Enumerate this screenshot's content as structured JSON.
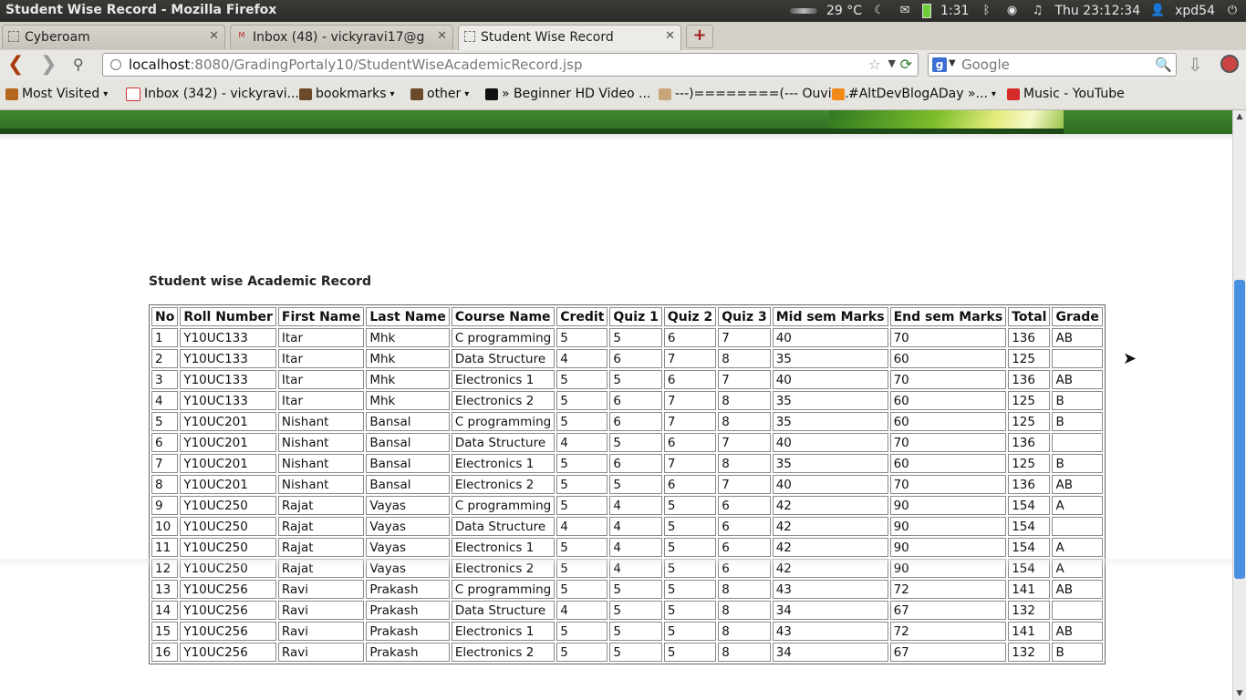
{
  "system_panel": {
    "window_title": "Student Wise Record - Mozilla Firefox",
    "temperature": "29 °C",
    "battery_time": "1:31",
    "clock": "Thu 23:12:34",
    "user": "xpd54"
  },
  "tabs": [
    {
      "label": "Cyberoam",
      "active": false
    },
    {
      "label": "Inbox (48) - vickyravi17@g...",
      "active": false
    },
    {
      "label": "Student Wise Record",
      "active": true
    }
  ],
  "nav": {
    "url_host": "localhost",
    "url_path": ":8080/GradingPortaly10/StudentWiseAcademicRecord.jsp",
    "search_placeholder": "Google"
  },
  "bookmarks": [
    {
      "label": "Most Visited",
      "menu": true
    },
    {
      "label": "Inbox (342) - vickyravi...",
      "menu": false
    },
    {
      "label": "bookmarks",
      "menu": true
    },
    {
      "label": "other",
      "menu": true
    },
    {
      "label": "» Beginner HD Video ...",
      "menu": false
    },
    {
      "label": "---)========(--- Ouvir ...",
      "menu": false
    },
    {
      "label": "#AltDevBlogADay »...",
      "menu": true
    },
    {
      "label": "Music - YouTube",
      "menu": false
    }
  ],
  "page": {
    "title": "Student wise Academic Record",
    "columns": [
      "No",
      "Roll Number",
      "First Name",
      "Last Name",
      "Course Name",
      "Credit",
      "Quiz 1",
      "Quiz 2",
      "Quiz 3",
      "Mid sem Marks",
      "End sem Marks",
      "Total",
      "Grade"
    ],
    "rows": [
      [
        "1",
        "Y10UC133",
        "Itar",
        "Mhk",
        "C programming",
        "5",
        "5",
        "6",
        "7",
        "40",
        "70",
        "136",
        "AB"
      ],
      [
        "2",
        "Y10UC133",
        "Itar",
        "Mhk",
        "Data Structure",
        "4",
        "6",
        "7",
        "8",
        "35",
        "60",
        "125",
        ""
      ],
      [
        "3",
        "Y10UC133",
        "Itar",
        "Mhk",
        "Electronics 1",
        "5",
        "5",
        "6",
        "7",
        "40",
        "70",
        "136",
        "AB"
      ],
      [
        "4",
        "Y10UC133",
        "Itar",
        "Mhk",
        "Electronics 2",
        "5",
        "6",
        "7",
        "8",
        "35",
        "60",
        "125",
        "B"
      ],
      [
        "5",
        "Y10UC201",
        "Nishant",
        "Bansal",
        "C programming",
        "5",
        "6",
        "7",
        "8",
        "35",
        "60",
        "125",
        "B"
      ],
      [
        "6",
        "Y10UC201",
        "Nishant",
        "Bansal",
        "Data Structure",
        "4",
        "5",
        "6",
        "7",
        "40",
        "70",
        "136",
        ""
      ],
      [
        "7",
        "Y10UC201",
        "Nishant",
        "Bansal",
        "Electronics 1",
        "5",
        "6",
        "7",
        "8",
        "35",
        "60",
        "125",
        "B"
      ],
      [
        "8",
        "Y10UC201",
        "Nishant",
        "Bansal",
        "Electronics 2",
        "5",
        "5",
        "6",
        "7",
        "40",
        "70",
        "136",
        "AB"
      ],
      [
        "9",
        "Y10UC250",
        "Rajat",
        "Vayas",
        "C programming",
        "5",
        "4",
        "5",
        "6",
        "42",
        "90",
        "154",
        "A"
      ],
      [
        "10",
        "Y10UC250",
        "Rajat",
        "Vayas",
        "Data Structure",
        "4",
        "4",
        "5",
        "6",
        "42",
        "90",
        "154",
        ""
      ],
      [
        "11",
        "Y10UC250",
        "Rajat",
        "Vayas",
        "Electronics 1",
        "5",
        "4",
        "5",
        "6",
        "42",
        "90",
        "154",
        "A"
      ],
      [
        "12",
        "Y10UC250",
        "Rajat",
        "Vayas",
        "Electronics 2",
        "5",
        "4",
        "5",
        "6",
        "42",
        "90",
        "154",
        "A"
      ],
      [
        "13",
        "Y10UC256",
        "Ravi",
        "Prakash",
        "C programming",
        "5",
        "5",
        "5",
        "8",
        "43",
        "72",
        "141",
        "AB"
      ],
      [
        "14",
        "Y10UC256",
        "Ravi",
        "Prakash",
        "Data Structure",
        "4",
        "5",
        "5",
        "8",
        "34",
        "67",
        "132",
        ""
      ],
      [
        "15",
        "Y10UC256",
        "Ravi",
        "Prakash",
        "Electronics 1",
        "5",
        "5",
        "5",
        "8",
        "43",
        "72",
        "141",
        "AB"
      ],
      [
        "16",
        "Y10UC256",
        "Ravi",
        "Prakash",
        "Electronics 2",
        "5",
        "5",
        "5",
        "8",
        "34",
        "67",
        "132",
        "B"
      ]
    ]
  }
}
